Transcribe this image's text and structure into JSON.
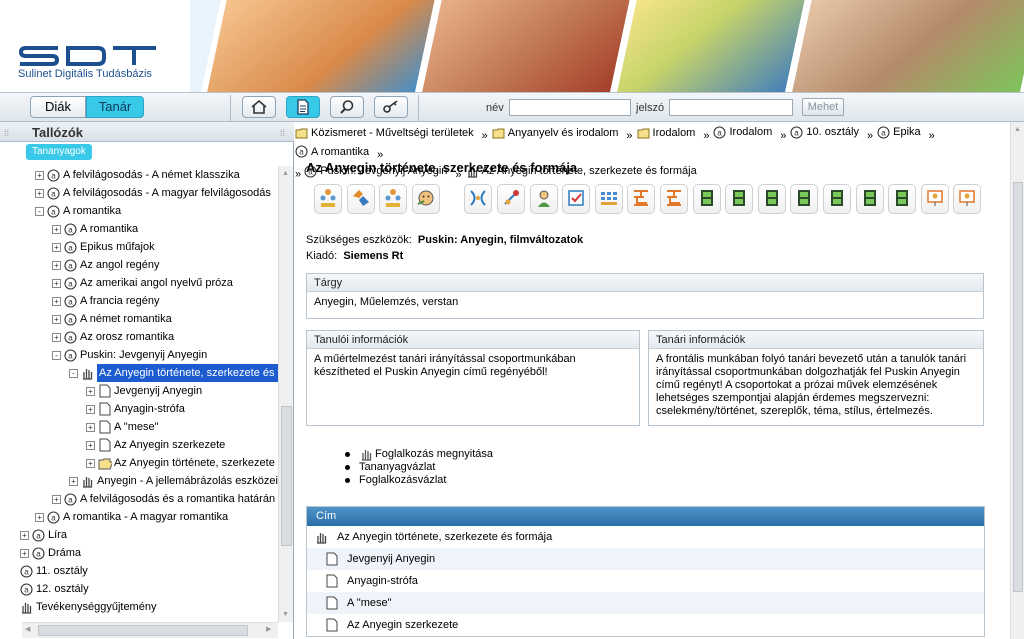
{
  "header": {
    "logo_text": "SDT",
    "logo_subtitle": "Sulinet Digitális Tudásbázis"
  },
  "topbar": {
    "role_student": "Diák",
    "role_teacher": "Tanár",
    "tools": [
      "home-icon",
      "document-icon",
      "search-icon",
      "key-icon"
    ],
    "name_label": "név",
    "name_value": "",
    "password_label": "jelszó",
    "password_value": "",
    "go_button": "Mehet"
  },
  "sidebar": {
    "title": "Tallózók",
    "tab": "Tananyagok",
    "tree": [
      {
        "label": "A felvilágosodás - A német klasszika",
        "level": 1,
        "pm": "+",
        "icon": "topic"
      },
      {
        "label": "A felvilágosodás - A magyar felvilágosodás",
        "level": 1,
        "pm": "+",
        "icon": "topic"
      },
      {
        "label": "A romantika",
        "level": 1,
        "pm": "-",
        "icon": "topic"
      },
      {
        "label": "A romantika",
        "level": 2,
        "pm": "+",
        "icon": "topic"
      },
      {
        "label": "Epikus műfajok",
        "level": 2,
        "pm": "+",
        "icon": "topic"
      },
      {
        "label": "Az angol regény",
        "level": 2,
        "pm": "+",
        "icon": "topic"
      },
      {
        "label": "Az amerikai angol nyelvű próza",
        "level": 2,
        "pm": "+",
        "icon": "topic"
      },
      {
        "label": "A francia regény",
        "level": 2,
        "pm": "+",
        "icon": "topic"
      },
      {
        "label": "A német romantika",
        "level": 2,
        "pm": "+",
        "icon": "topic"
      },
      {
        "label": "Az orosz romantika",
        "level": 2,
        "pm": "+",
        "icon": "topic"
      },
      {
        "label": "Puskin: Jevgenyij Anyegin",
        "level": 2,
        "pm": "-",
        "icon": "topic"
      },
      {
        "label": "Az Anyegin története, szerkezete és formája",
        "level": 3,
        "pm": "-",
        "icon": "hand",
        "selected": true
      },
      {
        "label": "Jevgenyij Anyegin",
        "level": 4,
        "pm": "+",
        "icon": "page"
      },
      {
        "label": "Anyagin-strófa",
        "level": 4,
        "pm": "+",
        "icon": "page"
      },
      {
        "label": "A \"mese\"",
        "level": 4,
        "pm": "+",
        "icon": "page"
      },
      {
        "label": "Az Anyegin szerkezete",
        "level": 4,
        "pm": "+",
        "icon": "page"
      },
      {
        "label": "Az Anyegin története, szerkezete",
        "level": 4,
        "pm": "+",
        "icon": "folder-open"
      },
      {
        "label": "Anyegin - A jellemábrázolás eszközei",
        "level": 3,
        "pm": "+",
        "icon": "hand"
      },
      {
        "label": "A felvilágosodás és a romantika határán",
        "level": 2,
        "pm": "+",
        "icon": "topic"
      },
      {
        "label": "A romantika - A magyar romantika",
        "level": 1,
        "pm": "+",
        "icon": "topic"
      },
      {
        "label": "Líra",
        "level": 0,
        "pm": "+",
        "icon": "topic"
      },
      {
        "label": "Dráma",
        "level": 0,
        "pm": "+",
        "icon": "topic"
      },
      {
        "label": "11. osztály",
        "level": -1,
        "pm": "",
        "icon": "topic"
      },
      {
        "label": "12. osztály",
        "level": -1,
        "pm": "",
        "icon": "topic"
      },
      {
        "label": "Tevékenységgyűjtemény",
        "level": -1,
        "pm": "",
        "icon": "hand"
      }
    ]
  },
  "breadcrumb": [
    {
      "label": "Közismeret - Műveltségi területek",
      "icon": "folder"
    },
    {
      "label": "Anyanyelv és irodalom",
      "icon": "folder"
    },
    {
      "label": "Irodalom",
      "icon": "folder"
    },
    {
      "label": "Irodalom",
      "icon": "topic"
    },
    {
      "label": "10. osztály",
      "icon": "topic"
    },
    {
      "label": "Epika",
      "icon": "topic"
    },
    {
      "label": "A romantika",
      "icon": "topic"
    },
    {
      "label": "Puskin: Jevgenyij Anyegin",
      "icon": "topic"
    },
    {
      "label": "Az Anyegin története, szerkezete és formája",
      "icon": "hand"
    }
  ],
  "main": {
    "title": "Az Anyegin története, szerkezete és formája",
    "icon_buttons": [
      "group-icon",
      "puzzle-icon",
      "group-icon",
      "face-icon",
      "scissors-icon",
      "science-icon",
      "person-icon",
      "checklist-icon",
      "grid-icon",
      "maze-icon",
      "maze-icon",
      "film-icon",
      "film-icon",
      "film-icon",
      "film-icon",
      "film-icon",
      "film-icon",
      "film-icon",
      "presentation-icon",
      "presentation-icon"
    ],
    "required_label": "Szükséges eszközök:",
    "required_value": "Puskin: Anyegin, filmváltozatok",
    "publisher_label": "Kiadó:",
    "publisher_value": "Siemens Rt",
    "subject_title": "Tárgy",
    "subject_text": "Anyegin, Műelemzés, verstan",
    "student_info_title": "Tanulói információk",
    "student_info_text": "A műértelmezést tanári irányítással csoportmunkában készítheted el Puskin Anyegin című regényéből!",
    "teacher_info_title": "Tanári információk",
    "teacher_info_text": "A frontális munkában folyó tanári bevezető után a tanulók tanári irányítással csoportmunkában dolgozhatják fel Puskin Anyegin című regényt! A csoportokat a prózai művek elemzésének lehetséges szempontjai alapján érdemes megszervezni: cselekmény/történet, szereplők, téma, stílus, értelmezés.",
    "links": [
      "Foglalkozás megnyitása",
      "Tananyagvázlat",
      "Foglalkozásvázlat"
    ],
    "table_header": "Cím",
    "table_rows": [
      {
        "label": "Az Anyegin története, szerkezete és formája",
        "icon": "hand"
      },
      {
        "label": "Jevgenyij Anyegin",
        "icon": "page"
      },
      {
        "label": "Anyagin-strófa",
        "icon": "page"
      },
      {
        "label": "A \"mese\"",
        "icon": "page"
      },
      {
        "label": "Az Anyegin szerkezete",
        "icon": "page"
      }
    ]
  }
}
